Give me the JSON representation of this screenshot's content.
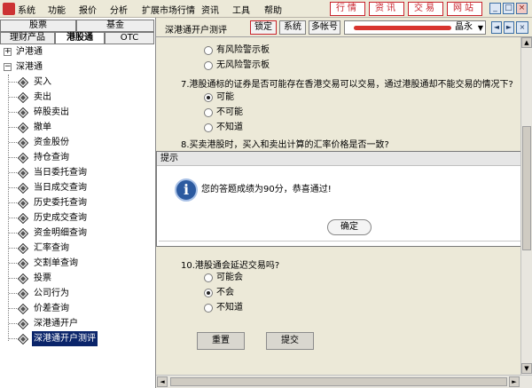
{
  "menu": [
    "系统",
    "功能",
    "报价",
    "分析",
    "扩展市场行情",
    "资讯",
    "工具",
    "帮助"
  ],
  "quick_buttons": [
    "行情",
    "资讯",
    "交易",
    "网站"
  ],
  "window_controls": [
    "_",
    "□",
    "×"
  ],
  "left_tabs_row1": [
    "股票",
    "基金"
  ],
  "left_tabs_row2": [
    "理财产品",
    "港股通",
    "OTC"
  ],
  "tree": {
    "root1": {
      "label": "沪港通",
      "expander": "+"
    },
    "root2": {
      "label": "深港通",
      "expander": "−"
    },
    "items": [
      "买入",
      "卖出",
      "碎股卖出",
      "撤单",
      "资金股份",
      "持仓查询",
      "当日委托查询",
      "当日成交查询",
      "历史委托查询",
      "历史成交查询",
      "资金明细查询",
      "汇率查询",
      "交割单查询",
      "投票",
      "公司行为",
      "价差查询",
      "深港通开户",
      "深港通开户测评"
    ],
    "selected": "深港通开户测评"
  },
  "header": {
    "title": "深港通开户测评",
    "confirm_btn": "锁定",
    "system_btn": "系统",
    "multi_account_btn": "多帐号",
    "account_suffix": "晶永",
    "account_arrow": "▼",
    "prev": "◄",
    "next": "►"
  },
  "questions": {
    "q6_options": [
      "有风险警示板",
      "无风险警示板"
    ],
    "q7": "7.港股通标的证券是否可能存在香港交易可以交易，通过港股通却不能交易的情况下?",
    "q7_options": [
      "可能",
      "不可能",
      "不知道"
    ],
    "q8": "8.买卖港股时，买入和卖出计算的汇率价格是否一致?",
    "q10": "10.港股通会延迟交易吗?",
    "q10_options": [
      "可能会",
      "不会",
      "不知道"
    ]
  },
  "dialog": {
    "title": "提示",
    "message": "您的答题成绩为90分，恭喜通过!",
    "ok": "确定"
  },
  "actions": {
    "reset": "重置",
    "submit": "提交"
  },
  "scroll": {
    "up": "▲",
    "down": "▼",
    "left": "◄",
    "right": "►"
  }
}
